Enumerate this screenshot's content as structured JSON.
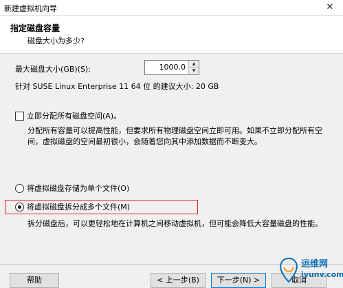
{
  "window": {
    "title": "新建虚拟机向导",
    "close_glyph": "✕"
  },
  "header": {
    "title": "指定磁盘容量",
    "subtitle": "磁盘大小为多少?"
  },
  "size": {
    "label": "最大磁盘大小(GB)(S):",
    "value": "1000.0",
    "up_glyph": "▲",
    "down_glyph": "▼"
  },
  "recommend": {
    "text": "针对 SUSE Linux Enterprise 11 64 位 的建议大小: 20 GB"
  },
  "allocate": {
    "label": "立即分配所有磁盘空间(A)。",
    "checked": false,
    "description": "分配所有容量可以提高性能，但要求所有物理磁盘空间立即可用。如果不立即分配所有空间，虚拟磁盘的空间最初很小，会随着您向其中添加数据而不断变大。"
  },
  "storage_options": [
    {
      "label": "将虚拟磁盘存储为单个文件(O)",
      "selected": false
    },
    {
      "label": "将虚拟磁盘拆分成多个文件(M)",
      "selected": true
    }
  ],
  "split_description": "拆分磁盘后，可以更轻松地在计算机之间移动虚拟机，但可能会降低大容量磁盘的性能。",
  "buttons": {
    "help": "帮助",
    "back": "< 上一步(B)",
    "next": "下一步(N) >",
    "cancel": "取消"
  },
  "watermark": {
    "line1": "运维网",
    "line2": "iyunv.com"
  },
  "colors": {
    "highlight_border": "#e02020",
    "watermark": "#0c6fb5"
  }
}
